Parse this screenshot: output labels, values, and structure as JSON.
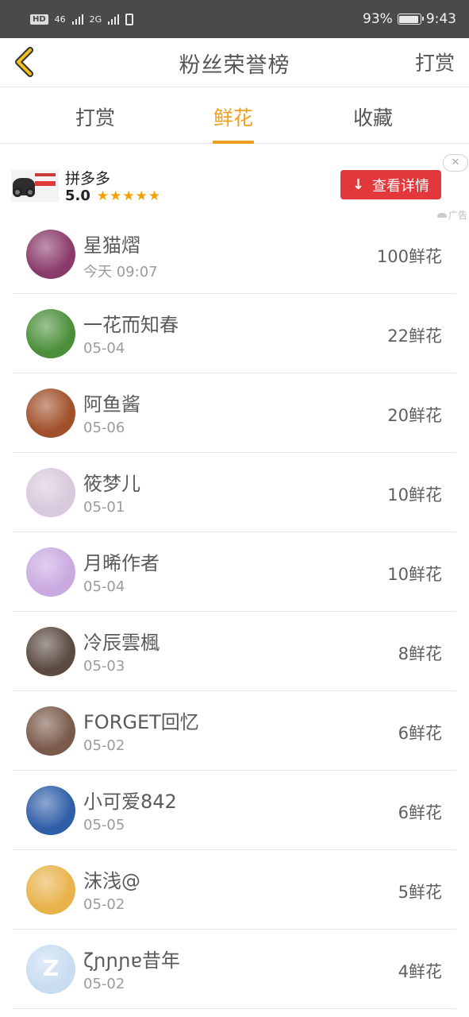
{
  "status_bar": {
    "hd_badge": "HD",
    "net_1": "46",
    "net_2": "2G",
    "battery_percent": "93%",
    "battery_level": 0.93,
    "time": "9:43"
  },
  "header": {
    "back_icon": "chevron-left-icon",
    "title": "粉丝荣誉榜",
    "right_link": "打赏"
  },
  "tabs": [
    {
      "label": "打赏",
      "active": false
    },
    {
      "label": "鲜花",
      "active": true
    },
    {
      "label": "收藏",
      "active": false
    }
  ],
  "colors": {
    "accent": "#f0a020",
    "ad_button": "#e2373b",
    "star": "#f5a000"
  },
  "ad": {
    "app_name": "拼多多",
    "rating": "5.0",
    "stars": "★★★★★",
    "button_label": "查看详情",
    "download_icon": "↓",
    "close_icon": "✕",
    "label": "广告"
  },
  "fans": [
    {
      "name": "星猫熠",
      "date": "今天 09:07",
      "count": "100鲜花",
      "avatar_color": "#8a3a6a",
      "avatar_glyph": ""
    },
    {
      "name": "一花而知春",
      "date": "05-04",
      "count": "22鲜花",
      "avatar_color": "#4b8f3a",
      "avatar_glyph": ""
    },
    {
      "name": "阿鱼酱",
      "date": "05-06",
      "count": "20鲜花",
      "avatar_color": "#a0502a",
      "avatar_glyph": ""
    },
    {
      "name": "筱梦儿",
      "date": "05-01",
      "count": "10鲜花",
      "avatar_color": "#d8c8dc",
      "avatar_glyph": ""
    },
    {
      "name": "月晞作者",
      "date": "05-04",
      "count": "10鲜花",
      "avatar_color": "#c9a9e0",
      "avatar_glyph": ""
    },
    {
      "name": "冷辰雲楓",
      "date": "05-03",
      "count": "8鲜花",
      "avatar_color": "#5a4a40",
      "avatar_glyph": ""
    },
    {
      "name": "FORGET回忆",
      "date": "05-02",
      "count": "6鲜花",
      "avatar_color": "#7a5a4a",
      "avatar_glyph": ""
    },
    {
      "name": "小可爱842",
      "date": "05-05",
      "count": "6鲜花",
      "avatar_color": "#2f5ea8",
      "avatar_glyph": ""
    },
    {
      "name": "沫浅@",
      "date": "05-02",
      "count": "5鲜花",
      "avatar_color": "#e8b24a",
      "avatar_glyph": ""
    },
    {
      "name": "ζɲɲɲɐ昔年",
      "date": "05-02",
      "count": "4鲜花",
      "avatar_color": "#c8dcf0",
      "avatar_glyph": "Z"
    }
  ]
}
